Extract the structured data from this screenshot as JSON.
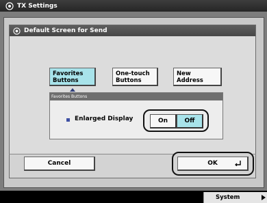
{
  "window": {
    "title": "TX Settings"
  },
  "dialog": {
    "title": "Default Screen for Send"
  },
  "tabs": [
    {
      "label_line1": "Favorites",
      "label_line2": "Buttons",
      "selected": true
    },
    {
      "label_line1": "One-touch",
      "label_line2": "Buttons",
      "selected": false
    },
    {
      "label_line1": "New",
      "label_line2": "Address",
      "selected": false
    }
  ],
  "group": {
    "header": "Favorites Buttons",
    "setting_label": "Enlarged Display",
    "on_label": "On",
    "off_label": "Off",
    "selected": "Off"
  },
  "footer": {
    "cancel_label": "Cancel",
    "ok_label": "OK"
  },
  "statusbar": {
    "system_monitor_label": "System Monitor"
  },
  "icons": {
    "title": "settings-gear-icon",
    "ok": "enter-return-icon",
    "status": "arrow-right-icon"
  },
  "colors": {
    "selected_button": "#a8e3ea",
    "accent_bullet": "#3d4fa3"
  }
}
